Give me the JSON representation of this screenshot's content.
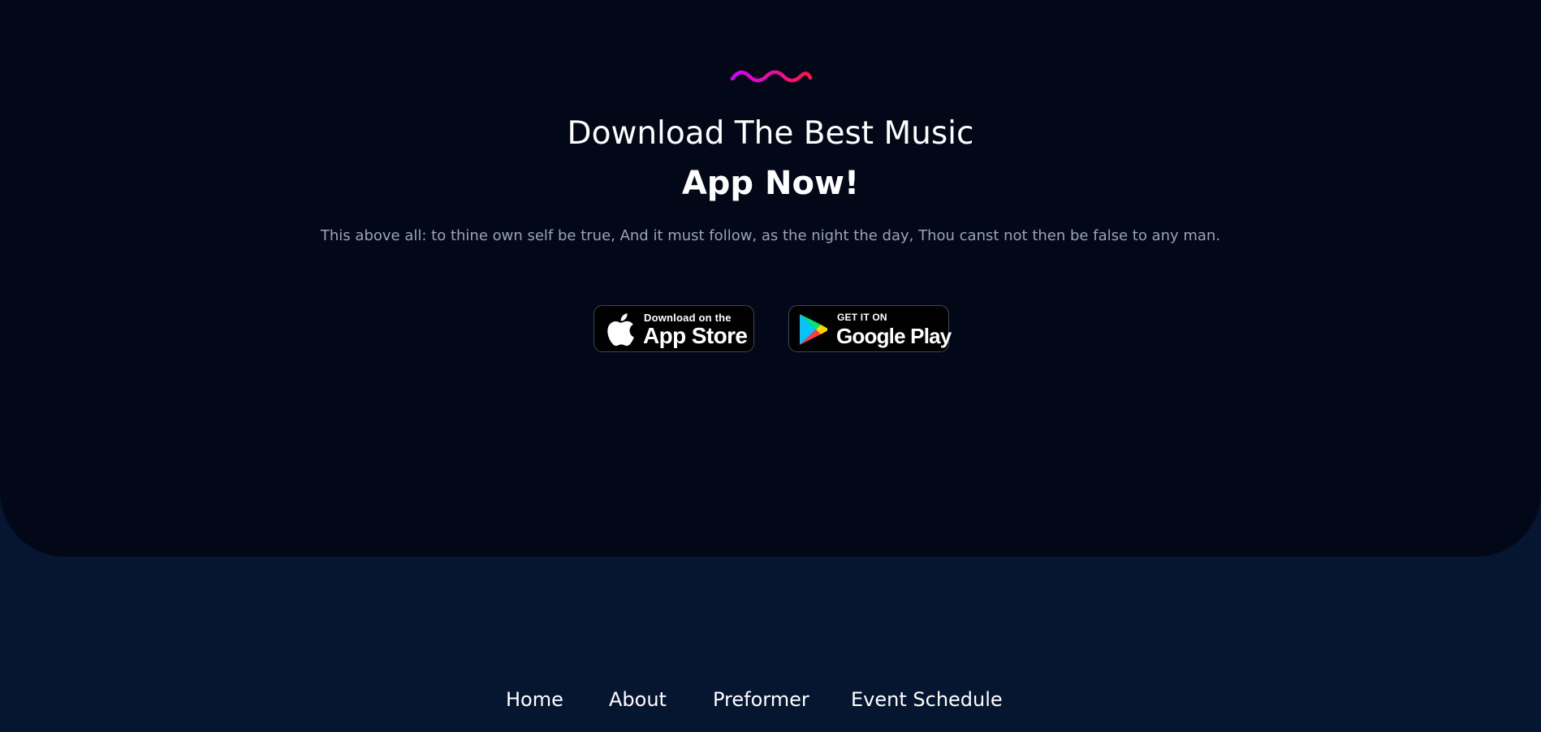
{
  "hero": {
    "decoration": "wave-icon",
    "title_line1": "Download The Best Music",
    "title_line2": "App Now!",
    "subtitle": "This above all: to thine own self be true, And it must follow, as the night the day, Thou canst not then be false to any man.",
    "wave_colors": [
      "#d400ff",
      "#ff1744"
    ]
  },
  "stores": {
    "apple": {
      "icon": "apple-icon",
      "small": "Download on the",
      "big": "App Store"
    },
    "google": {
      "icon": "google-play-icon",
      "small": "GET IT ON",
      "big": "Google Play"
    }
  },
  "footer_nav": {
    "items": [
      "Home",
      "About",
      "Preformer",
      "Event Schedule"
    ]
  },
  "colors": {
    "page_background": "#061530",
    "hero_background": "#020817",
    "subtitle_text": "#9aa3b6",
    "store_border": "#3d4658"
  }
}
